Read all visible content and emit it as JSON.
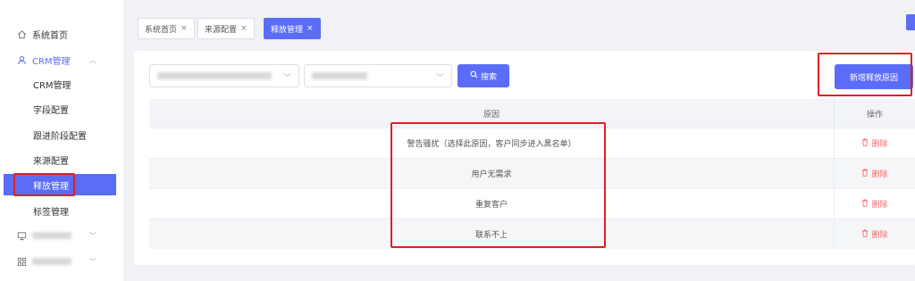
{
  "sidebar": {
    "home": "系统首页",
    "crm_group": "CRM管理",
    "sub_items": [
      "CRM管理",
      "字段配置",
      "跟进阶段配置",
      "来源配置",
      "释放管理",
      "标签管理"
    ]
  },
  "tabs": [
    {
      "label": "系统首页"
    },
    {
      "label": "来源配置"
    },
    {
      "label": "释放管理"
    }
  ],
  "tab_close": "×",
  "toolbar": {
    "search_label": "搜索",
    "add_label": "新增释放原因"
  },
  "table": {
    "header_reason": "原因",
    "header_op": "操作",
    "delete_label": "删除",
    "rows": [
      "警告骚扰（选择此原因，客户同步进入黑名单）",
      "用户无需求",
      "重复客户",
      "联系不上"
    ]
  },
  "colors": {
    "primary": "#5b6cf6",
    "danger": "#f56c6c",
    "annotation": "#e02020"
  }
}
